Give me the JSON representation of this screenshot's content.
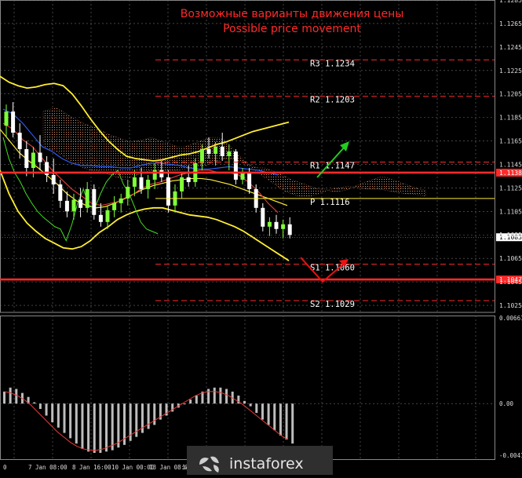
{
  "chart_data": [
    {
      "type": "candlestick",
      "title": "Возможные варианты движения цены",
      "subtitle": "Possible price movement",
      "colors": {
        "background": "#000000",
        "grid": "#6e6e6e",
        "candle_up": "#7fff3a",
        "candle_down": "#ffffff",
        "bollinger": "#ffee33",
        "kijun": "#e83a3a",
        "tenkun": "#3060ff",
        "chikou": "#44dd22",
        "cloud": "#d98f6a",
        "title": "#ff2a2a",
        "levels": "#ff2a2a",
        "level_text": "#ffffff",
        "arrow_up": "#22cc22",
        "arrow_down": "#ee1111"
      },
      "ylim": [
        1.1019,
        1.1285
      ],
      "price_axis_ticks": [
        "1.1285",
        "1.1265",
        "1.1245",
        "1.1225",
        "1.1205",
        "1.1185",
        "1.1165",
        "1.1145",
        "1.1125",
        "1.1105",
        "1.1085",
        "1.1065",
        "1.1045",
        "1.1025"
      ],
      "time_axis_labels": [
        "0",
        "7 Jan 08:00",
        "8 Jan 16:00",
        "10 Jan 00:00",
        "13 Jan 08:00",
        "14 Jan"
      ],
      "current_price": "1.1083",
      "marked_prices": [
        {
          "label": "1.1138",
          "value": 1.1138
        },
        {
          "label": "1.1047",
          "value": 1.1047
        }
      ],
      "pivot_levels": [
        {
          "name": "R3",
          "value": 1.1234,
          "label": "R3 1.1234"
        },
        {
          "name": "R2",
          "value": 1.1203,
          "label": "R2 1.1203"
        },
        {
          "name": "R1",
          "value": 1.1147,
          "label": "R1 1.1147"
        },
        {
          "name": "P",
          "value": 1.1116,
          "label": "P 1.1116"
        },
        {
          "name": "S1",
          "value": 1.106,
          "label": "S1 1.1060"
        },
        {
          "name": "S2",
          "value": 1.1029,
          "label": "S2 1.1029"
        }
      ],
      "strong_levels": [
        1.1138,
        1.1047
      ],
      "candles": [
        [
          1.1178,
          1.1196,
          1.1168,
          1.119
        ],
        [
          1.119,
          1.1198,
          1.1168,
          1.1172
        ],
        [
          1.1172,
          1.118,
          1.115,
          1.1158
        ],
        [
          1.1158,
          1.1165,
          1.1135,
          1.1142
        ],
        [
          1.1142,
          1.116,
          1.1134,
          1.1155
        ],
        [
          1.1155,
          1.117,
          1.114,
          1.1147
        ],
        [
          1.1147,
          1.1152,
          1.113,
          1.1136
        ],
        [
          1.1136,
          1.115,
          1.112,
          1.1128
        ],
        [
          1.1128,
          1.1132,
          1.1108,
          1.1114
        ],
        [
          1.1114,
          1.1122,
          1.11,
          1.1105
        ],
        [
          1.1105,
          1.112,
          1.1098,
          1.1115
        ],
        [
          1.1115,
          1.1125,
          1.11,
          1.1108
        ],
        [
          1.1108,
          1.113,
          1.1104,
          1.1124
        ],
        [
          1.1124,
          1.1128,
          1.1098,
          1.1102
        ],
        [
          1.1102,
          1.1112,
          1.1092,
          1.1096
        ],
        [
          1.1096,
          1.111,
          1.109,
          1.1106
        ],
        [
          1.1106,
          1.1118,
          1.11,
          1.1112
        ],
        [
          1.1112,
          1.112,
          1.1104,
          1.1116
        ],
        [
          1.1116,
          1.1132,
          1.111,
          1.1126
        ],
        [
          1.1126,
          1.114,
          1.1118,
          1.1134
        ],
        [
          1.1134,
          1.1142,
          1.112,
          1.1124
        ],
        [
          1.1124,
          1.1136,
          1.1116,
          1.1132
        ],
        [
          1.1132,
          1.1146,
          1.1124,
          1.114
        ],
        [
          1.114,
          1.1148,
          1.113,
          1.1134
        ],
        [
          1.1134,
          1.114,
          1.1104,
          1.111
        ],
        [
          1.111,
          1.1128,
          1.1104,
          1.1122
        ],
        [
          1.1122,
          1.1138,
          1.1116,
          1.1134
        ],
        [
          1.1134,
          1.1144,
          1.1126,
          1.113
        ],
        [
          1.113,
          1.115,
          1.1126,
          1.1146
        ],
        [
          1.1146,
          1.1162,
          1.114,
          1.1158
        ],
        [
          1.1158,
          1.1168,
          1.115,
          1.1154
        ],
        [
          1.1154,
          1.1164,
          1.1144,
          1.116
        ],
        [
          1.116,
          1.1172,
          1.1148,
          1.1152
        ],
        [
          1.1152,
          1.1162,
          1.114,
          1.1156
        ],
        [
          1.1156,
          1.1158,
          1.1128,
          1.1132
        ],
        [
          1.1132,
          1.1142,
          1.1128,
          1.1138
        ],
        [
          1.1138,
          1.1142,
          1.112,
          1.1124
        ],
        [
          1.1124,
          1.1128,
          1.1104,
          1.1108
        ],
        [
          1.1108,
          1.1112,
          1.1088,
          1.1092
        ],
        [
          1.1092,
          1.11,
          1.1084,
          1.1096
        ],
        [
          1.1096,
          1.1102,
          1.1086,
          1.109
        ],
        [
          1.109,
          1.1098,
          1.1082,
          1.1094
        ],
        [
          1.1094,
          1.11,
          1.1082,
          1.1085
        ]
      ],
      "bollinger_upper": [
        1.122,
        1.1215,
        1.1212,
        1.121,
        1.1211,
        1.1213,
        1.1214,
        1.1212,
        1.1205,
        1.1195,
        1.1184,
        1.1174,
        1.1165,
        1.1158,
        1.1152,
        1.115,
        1.1149,
        1.1148,
        1.1149,
        1.1151,
        1.1153,
        1.1154,
        1.1156,
        1.1159,
        1.1162,
        1.1164,
        1.1167,
        1.117,
        1.1173,
        1.1175,
        1.1177,
        1.1179,
        1.1181
      ],
      "bollinger_lower": [
        1.114,
        1.112,
        1.1105,
        1.1095,
        1.1088,
        1.1082,
        1.1078,
        1.1074,
        1.1073,
        1.1075,
        1.108,
        1.1087,
        1.1092,
        1.1098,
        1.1102,
        1.1105,
        1.1107,
        1.1108,
        1.1108,
        1.1106,
        1.1104,
        1.1102,
        1.1101,
        1.11,
        1.1098,
        1.1095,
        1.1092,
        1.1088,
        1.1083,
        1.1078,
        1.1073,
        1.1068,
        1.1063
      ],
      "bollinger_middle": [
        1.1175,
        1.1165,
        1.1155,
        1.1148,
        1.1142,
        1.1135,
        1.1128,
        1.112,
        1.1114,
        1.111,
        1.1108,
        1.1109,
        1.1112,
        1.1116,
        1.112,
        1.1124,
        1.1127,
        1.1129,
        1.1131,
        1.1132,
        1.1133,
        1.1133,
        1.1132,
        1.113,
        1.1128,
        1.1125,
        1.1122,
        1.1119,
        1.1116,
        1.1113,
        1.111
      ],
      "macd_ylim": [
        -0.00417,
        0.00661
      ],
      "macd_ticks": [
        "0.00661",
        "0.00",
        "-0.00417"
      ],
      "macd_bars": [
        0.0009,
        0.0012,
        0.0011,
        0.0008,
        0.0005,
        0.0001,
        -0.0004,
        -0.0009,
        -0.0014,
        -0.0018,
        -0.0022,
        -0.0026,
        -0.003,
        -0.0034,
        -0.0036,
        -0.0037,
        -0.0037,
        -0.0036,
        -0.0035,
        -0.0033,
        -0.0031,
        -0.0028,
        -0.0025,
        -0.0022,
        -0.0019,
        -0.0016,
        -0.0012,
        -0.0009,
        -0.0006,
        -0.0003,
        0.0,
        0.0003,
        0.0006,
        0.0009,
        0.0011,
        0.0012,
        0.0012,
        0.0011,
        0.0009,
        0.0006,
        0.0002,
        -0.0002,
        -0.0007,
        -0.0012,
        -0.0016,
        -0.002,
        -0.0024,
        -0.0027,
        -0.003
      ],
      "macd_signal": [
        0.0009,
        0.0008,
        0.0006,
        0.0003,
        -0.0001,
        -0.0006,
        -0.0011,
        -0.0016,
        -0.0021,
        -0.0025,
        -0.0029,
        -0.0032,
        -0.0034,
        -0.0035,
        -0.0035,
        -0.0034,
        -0.0032,
        -0.003,
        -0.0027,
        -0.0024,
        -0.0021,
        -0.0018,
        -0.0015,
        -0.0012,
        -0.0009,
        -0.0006,
        -0.0003,
        0.0,
        0.0003,
        0.0006,
        0.0008,
        0.0009,
        0.0009,
        0.0008,
        0.0006,
        0.0003,
        0.0,
        -0.0004,
        -0.0008,
        -0.0012,
        -0.0016,
        -0.002,
        -0.0024,
        -0.0027
      ]
    }
  ],
  "watermark": {
    "brand_text": "instaforex",
    "icon": "instaforex-logo-icon"
  }
}
